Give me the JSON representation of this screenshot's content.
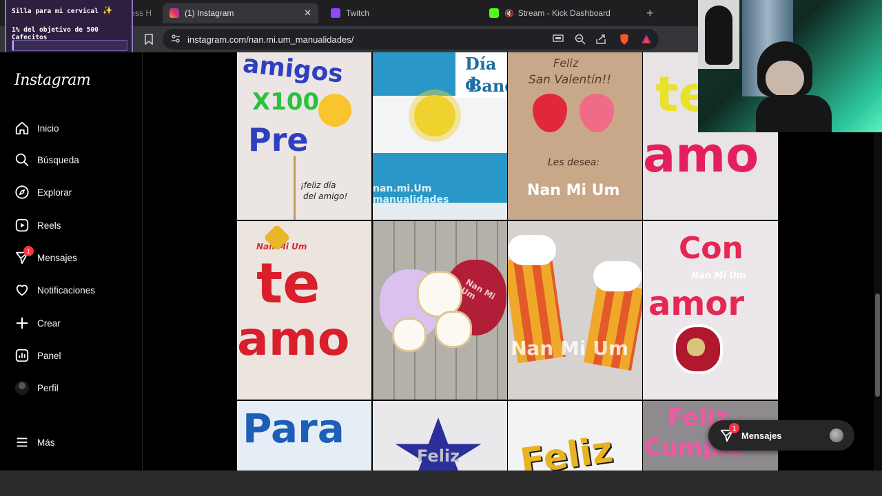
{
  "browser": {
    "tabs": [
      {
        "label": "ess H",
        "active": false
      },
      {
        "label": "(1) Instagram",
        "active": true
      },
      {
        "label": "Twitch",
        "active": false
      },
      {
        "label": "Stream - Kick Dashboard",
        "active": false
      }
    ],
    "new_tab": "+",
    "url": "instagram.com/nan.mi.um_manualidades/"
  },
  "goal_widget": {
    "title": "Silla para mi cervical",
    "progress_text": "1% del objetivo de 500 Cafecitos",
    "progress_fraction": 0.01
  },
  "instagram": {
    "logo": "Instagram",
    "nav": [
      {
        "label": "Inicio",
        "icon": "home-icon"
      },
      {
        "label": "Búsqueda",
        "icon": "search-icon"
      },
      {
        "label": "Explorar",
        "icon": "compass-icon"
      },
      {
        "label": "Reels",
        "icon": "reels-icon"
      },
      {
        "label": "Mensajes",
        "icon": "messenger-icon",
        "badge": "1"
      },
      {
        "label": "Notificaciones",
        "icon": "heart-icon"
      },
      {
        "label": "Crear",
        "icon": "plus-icon"
      },
      {
        "label": "Panel",
        "icon": "chart-icon"
      },
      {
        "label": "Perfil",
        "icon": "avatar-icon"
      },
      {
        "label": "Más",
        "icon": "menu-icon"
      }
    ],
    "messages_pill": {
      "label": "Mensajes",
      "badge": "1"
    }
  },
  "posts": [
    {
      "lines": [
        "amigos",
        "X100",
        "Pre",
        "¡feliz día",
        "del amigo!"
      ]
    },
    {
      "lines": [
        "Día d",
        "Band",
        "nan.mi.Um manualidades"
      ]
    },
    {
      "lines": [
        "Feliz",
        "San Valentín!!",
        "Les desea:",
        "Nan Mi Um"
      ]
    },
    {
      "lines": [
        "te",
        "amo"
      ]
    },
    {
      "lines": [
        "Nan Mi Um",
        "te",
        "amo"
      ]
    },
    {
      "lines": [
        "Nan Mi Um"
      ]
    },
    {
      "lines": [
        "Nan Mi Um"
      ]
    },
    {
      "lines": [
        "Con",
        "Nan Mi Um",
        "amor"
      ]
    },
    {
      "lines": [
        "Para"
      ]
    },
    {
      "lines": [
        "Feliz"
      ]
    },
    {
      "lines": [
        "Feliz"
      ]
    },
    {
      "lines": [
        "Feliz",
        "Cumple"
      ]
    }
  ],
  "colors": {
    "ig_background": "#000000",
    "notification_red": "#ff3040",
    "goal_border": "#8b79c7"
  }
}
